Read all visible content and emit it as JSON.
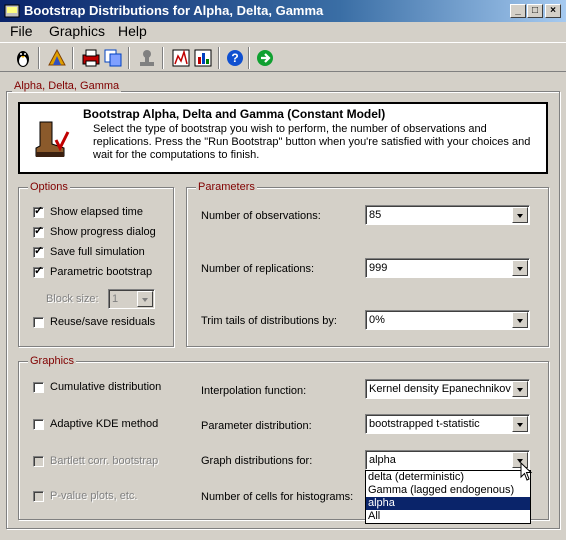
{
  "window": {
    "title": "Bootstrap Distributions for Alpha, Delta, Gamma"
  },
  "menu": {
    "items": [
      "File",
      "Graphics",
      "Help"
    ]
  },
  "toolbar": {
    "icons": [
      "penguin-icon",
      "app-icon",
      "print-icon",
      "copy-icon",
      "stamp-icon",
      "chart-icon",
      "graph-icon",
      "help-icon",
      "run-icon"
    ]
  },
  "frame": {
    "label": "Alpha, Delta, Gamma"
  },
  "banner": {
    "title": "Bootstrap Alpha, Delta and Gamma (Constant Model)",
    "description": "Select the type of bootstrap you wish to perform, the number of observations and replications. Press the \"Run Bootstrap\" button when you're satisfied with your choices and wait for the computations to finish."
  },
  "options": {
    "label": "Options",
    "show_elapsed": {
      "label": "Show elapsed time",
      "checked": true
    },
    "show_progress": {
      "label": "Show progress dialog",
      "checked": true
    },
    "save_full": {
      "label": "Save full simulation",
      "checked": true
    },
    "parametric": {
      "label": "Parametric bootstrap",
      "checked": true
    },
    "block_size": {
      "label": "Block size:",
      "value": "1"
    },
    "reuse": {
      "label": "Reuse/save residuals",
      "checked": false
    }
  },
  "parameters": {
    "label": "Parameters",
    "observations": {
      "label": "Number of observations:",
      "value": "85"
    },
    "replications": {
      "label": "Number of replications:",
      "value": "999"
    },
    "trim": {
      "label": "Trim tails of distributions by:",
      "value": "0%"
    }
  },
  "graphics": {
    "label": "Graphics",
    "cumulative": {
      "label": "Cumulative distribution",
      "checked": false
    },
    "adaptive": {
      "label": "Adaptive KDE method",
      "checked": false
    },
    "bartlett": {
      "label": "Bartlett corr. bootstrap",
      "checked": false
    },
    "pvalue": {
      "label": "P-value plots, etc.",
      "checked": false
    },
    "interpolation": {
      "label": "Interpolation function:",
      "value": "Kernel density Epanechnikov"
    },
    "param_dist": {
      "label": "Parameter distribution:",
      "value": "bootstrapped t-statistic"
    },
    "graph_for": {
      "label": "Graph distributions for:",
      "value": "alpha"
    },
    "cells": {
      "label": "Number of cells for histograms:"
    },
    "dropdown_options": [
      "delta (deterministic)",
      "Gamma (lagged endogenous)",
      "alpha",
      "All"
    ],
    "dropdown_selected_index": 2
  },
  "colors": {
    "titlebar": "#0a246a",
    "group_label": "#800000",
    "selection": "#0a246a",
    "face": "#d4d0c8"
  }
}
